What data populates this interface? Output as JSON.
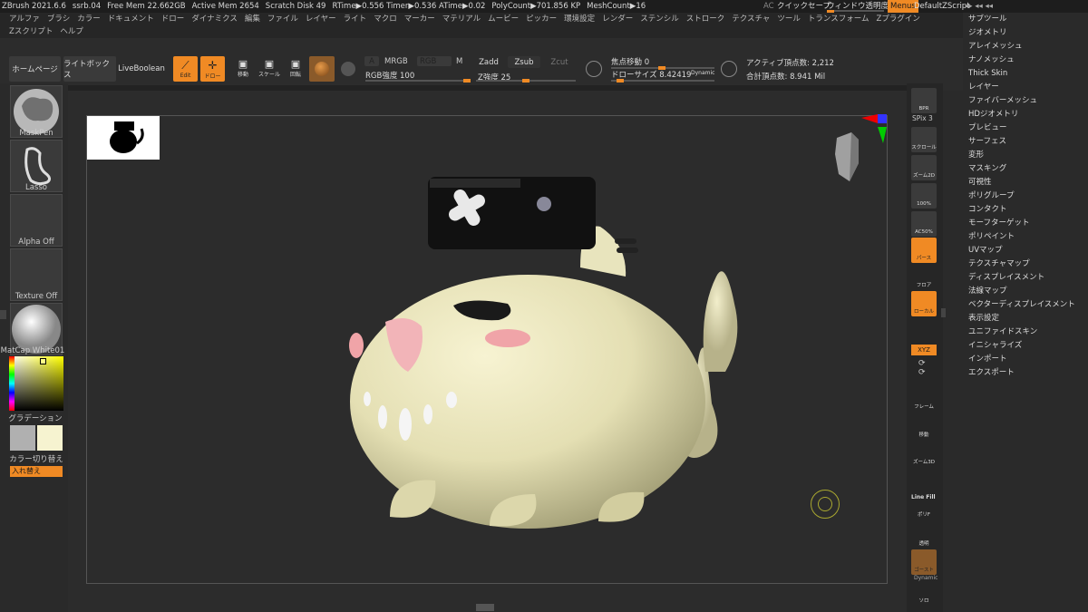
{
  "status": {
    "app": "ZBrush 2021.6.6",
    "file": "ssrb.04",
    "free_mem": "Free Mem 22.662GB",
    "active_mem": "Active Mem 2654",
    "scratch": "Scratch Disk 49",
    "rtime": "RTime▶0.556 Timer▶0.536 ATime▶0.02",
    "polycount": "PolyCount▶701.856 KP",
    "meshcount": "MeshCount▶16",
    "ac": "AC",
    "quicksave": "クイックセーブ",
    "transparency": "ウィンドウ透明度",
    "menus": "Menus",
    "script": "DefaultZScript"
  },
  "menu": [
    "アルファ",
    "ブラシ",
    "カラー",
    "ドキュメント",
    "ドロー",
    "ダイナミクス",
    "編集",
    "ファイル",
    "レイヤー",
    "ライト",
    "マクロ",
    "マーカー",
    "マテリアル",
    "ムービー",
    "ピッカー",
    "環境設定",
    "レンダー",
    "ステンシル",
    "ストローク",
    "テクスチャ",
    "ツール",
    "トランスフォーム",
    "Zプラグイン",
    "Zスクリプト",
    "ヘルプ"
  ],
  "toolbar": {
    "home": "ホームページ",
    "lightbox": "ライトボックス",
    "liveboolean": "LiveBoolean",
    "edit": "Edit",
    "draw": "ドロー",
    "move": "移動",
    "scale": "スケール",
    "rotate": "回転",
    "a": "A",
    "mrgb": "MRGB",
    "rgb": "RGB",
    "m": "M",
    "zadd": "Zadd",
    "zsub": "Zsub",
    "zcut": "Zcut",
    "rgb_intensity": "RGB強度 100",
    "z_intensity": "Z強度 25",
    "focal": "焦点移動 0",
    "draw_size": "ドローサイズ 8.42419",
    "dynamic": "Dynamic",
    "active_points": "アクティブ頂点数: 2,212",
    "total_points": "合計頂点数: 8.941 Mil"
  },
  "left": {
    "maskpen": "MaskPen",
    "lasso": "Lasso",
    "alpha": "Alpha Off",
    "texture": "Texture Off",
    "matcap": "MatCap White01",
    "gradient": "グラデーション",
    "switch": "カラー切り替え",
    "swap": "入れ替え"
  },
  "right": {
    "bpr": "BPR",
    "spix": "SPix 3",
    "scroll": "スクロール",
    "zoom2d": "ズーム2D",
    "p100": "100%",
    "ac50": "AC50%",
    "persp": "パース",
    "floor": "フロア",
    "local": "ローカル",
    "xyz": "XYZ",
    "frame": "フレーム",
    "move": "移動",
    "zoom3d": "ズーム3D",
    "linefill": "Line Fill",
    "polyf": "ポリF",
    "transp": "透明",
    "dyn": "Dynamic",
    "solo": "ソロ",
    "ghost": "ゴースト"
  },
  "menus": [
    "サブツール",
    "ジオメトリ",
    "アレイメッシュ",
    "ナノメッシュ",
    "Thick Skin",
    "レイヤー",
    "ファイバーメッシュ",
    "HDジオメトリ",
    "プレビュー",
    "サーフェス",
    "変形",
    "マスキング",
    "可視性",
    "ポリグループ",
    "コンタクト",
    "モーフターゲット",
    "ポリペイント",
    "UVマップ",
    "テクスチャマップ",
    "ディスプレイスメント",
    "法線マップ",
    "ベクターディスプレイスメント",
    "表示設定",
    "ユニファイドスキン",
    "イニシャライズ",
    "インポート",
    "エクスポート"
  ]
}
